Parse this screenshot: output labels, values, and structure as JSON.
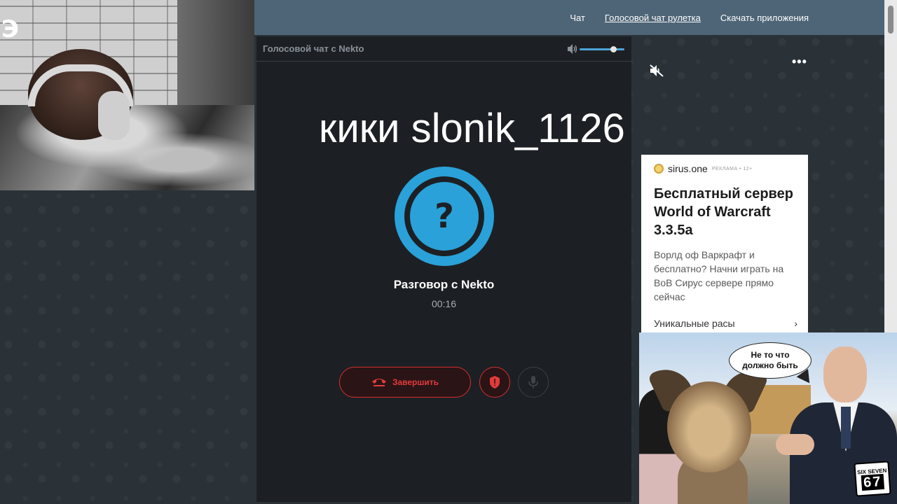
{
  "nav": {
    "items": [
      {
        "label": "Чат"
      },
      {
        "label": "Голосовой чат рулетка"
      },
      {
        "label": "Скачать приложения"
      }
    ]
  },
  "call": {
    "header_title": "Голосовой чат с Nekto",
    "avatar_symbol": "?",
    "name": "Разговор с Nekto",
    "timer": "00:16",
    "end_label": "Завершить",
    "volume_level": 0.8
  },
  "overlay": {
    "caption": "кики slonik_1126"
  },
  "ad": {
    "brand": "sirus.one",
    "tag": "РЕКЛАМА • 12+",
    "headline": "Бесплатный сервер World of Warcraft 3.3.5a",
    "body": "Ворлд оф Варкрафт и бесплатно? Начни играть на ВоВ Сирус сервере прямо сейчас",
    "link": "Уникальные расы",
    "link_arrow": "›"
  },
  "meme": {
    "bubble_line1": "Не то что",
    "bubble_line2": "должно быть",
    "logo_top": "SIX SEVEN",
    "logo_number": "67"
  },
  "webcam": {
    "badge": "Э"
  },
  "menu": {
    "dots": "•••"
  },
  "colors": {
    "topbar": "#4e6577",
    "panel": "#1c2024",
    "accent_blue": "#2aa1d8",
    "danger_red": "#d62f2f"
  }
}
